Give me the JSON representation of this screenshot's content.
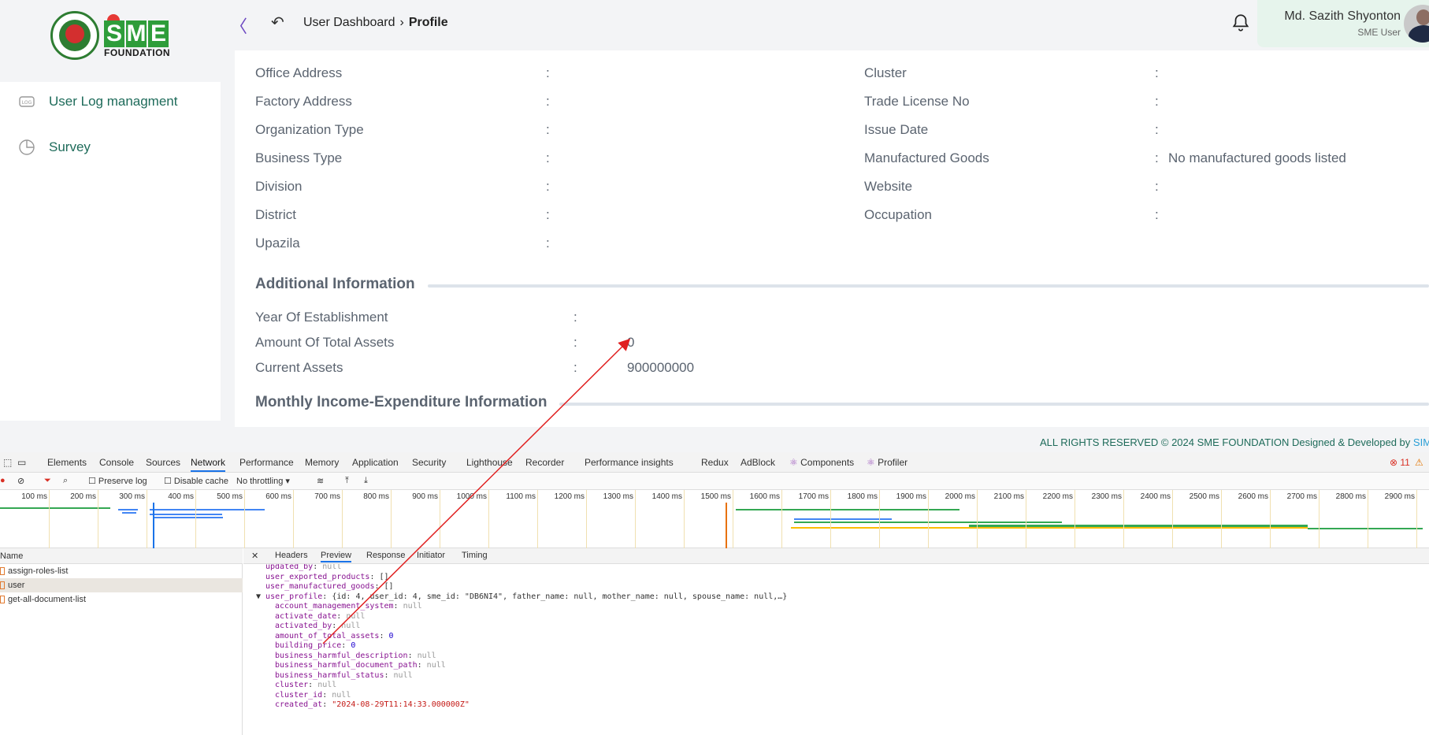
{
  "logo": {
    "sme_letters": [
      "S",
      "M",
      "E"
    ],
    "foundation": "FOUNDATION"
  },
  "header": {
    "breadcrumb": {
      "parent": "User Dashboard",
      "separator": "›",
      "current": "Profile"
    },
    "user": {
      "name": "Md. Sazith Shyonton",
      "role": "SME User"
    }
  },
  "sidebar": {
    "items": [
      {
        "label": "User Log managment",
        "icon": "log-icon"
      },
      {
        "label": "Survey",
        "icon": "pie-chart-icon"
      }
    ]
  },
  "profile": {
    "left_fields": [
      {
        "label": "Office Address",
        "value": ""
      },
      {
        "label": "Factory Address",
        "value": ""
      },
      {
        "label": "Organization Type",
        "value": ""
      },
      {
        "label": "Business Type",
        "value": ""
      },
      {
        "label": "Division",
        "value": ""
      },
      {
        "label": "District",
        "value": ""
      },
      {
        "label": "Upazila",
        "value": ""
      }
    ],
    "right_fields": [
      {
        "label": "Cluster",
        "value": ""
      },
      {
        "label": "Trade License No",
        "value": ""
      },
      {
        "label": "Issue Date",
        "value": ""
      },
      {
        "label": "Manufactured Goods",
        "value": "No manufactured goods listed"
      },
      {
        "label": "Website",
        "value": ""
      },
      {
        "label": "Occupation",
        "value": ""
      }
    ],
    "colon": ":",
    "additional_title": "Additional Information",
    "additional_fields": [
      {
        "label": "Year Of Establishment",
        "value": ""
      },
      {
        "label": "Amount Of Total Assets",
        "value": "0"
      },
      {
        "label": "Current Assets",
        "value": "900000000"
      }
    ],
    "monthly_title": "Monthly Income-Expenditure Information"
  },
  "footer": {
    "text": "ALL RIGHTS RESERVED © 2024 SME FOUNDATION    Designed & Developed by",
    "link": "SIMEC"
  },
  "devtools": {
    "tabs": [
      "Elements",
      "Console",
      "Sources",
      "Network",
      "Performance",
      "Memory",
      "Application",
      "Security",
      "Lighthouse",
      "Recorder",
      "Performance insights",
      "Redux",
      "AdBlock",
      "Components",
      "Profiler"
    ],
    "active_tab": "Network",
    "errors": "11",
    "toolbar": {
      "preserve_log": "Preserve log",
      "disable_cache": "Disable cache",
      "throttling": "No throttling"
    },
    "ticks": [
      "100 ms",
      "200 ms",
      "300 ms",
      "400 ms",
      "500 ms",
      "600 ms",
      "700 ms",
      "800 ms",
      "900 ms",
      "1000 ms",
      "1100 ms",
      "1200 ms",
      "1300 ms",
      "1400 ms",
      "1500 ms",
      "1600 ms",
      "1700 ms",
      "1800 ms",
      "1900 ms",
      "2000 ms",
      "2100 ms",
      "2200 ms",
      "2300 ms",
      "2400 ms",
      "2500 ms",
      "2600 ms",
      "2700 ms",
      "2800 ms",
      "2900 ms"
    ],
    "name_header": "Name",
    "requests": [
      "assign-roles-list",
      "user",
      "get-all-document-list"
    ],
    "detail_tabs": [
      "Headers",
      "Preview",
      "Response",
      "Initiator",
      "Timing"
    ],
    "active_detail_tab": "Preview",
    "preview_lines": [
      {
        "indent": 0,
        "key": "updated_by",
        "value": "null",
        "type": "null"
      },
      {
        "indent": 0,
        "key": "user_exported_products",
        "value": "[]",
        "type": "plain"
      },
      {
        "indent": 0,
        "key": "user_manufactured_goods",
        "value": "[]",
        "type": "plain"
      },
      {
        "indent": 0,
        "key": "user_profile",
        "value": "{id: 4, user_id: 4, sme_id: \"DB6NI4\", father_name: null, mother_name: null, spouse_name: null,…}",
        "type": "plain",
        "expanded": true
      },
      {
        "indent": 1,
        "key": "account_management_system",
        "value": "null",
        "type": "null"
      },
      {
        "indent": 1,
        "key": "activate_date",
        "value": "null",
        "type": "null"
      },
      {
        "indent": 1,
        "key": "activated_by",
        "value": "null",
        "type": "null"
      },
      {
        "indent": 1,
        "key": "amount_of_total_assets",
        "value": "0",
        "type": "num"
      },
      {
        "indent": 1,
        "key": "building_price",
        "value": "0",
        "type": "num"
      },
      {
        "indent": 1,
        "key": "business_harmful_description",
        "value": "null",
        "type": "null"
      },
      {
        "indent": 1,
        "key": "business_harmful_document_path",
        "value": "null",
        "type": "null"
      },
      {
        "indent": 1,
        "key": "business_harmful_status",
        "value": "null",
        "type": "null"
      },
      {
        "indent": 1,
        "key": "cluster",
        "value": "null",
        "type": "null"
      },
      {
        "indent": 1,
        "key": "cluster_id",
        "value": "null",
        "type": "null"
      },
      {
        "indent": 1,
        "key": "created_at",
        "value": "\"2024-08-29T11:14:33.000000Z\"",
        "type": "str"
      }
    ]
  },
  "colors": {
    "accent_green": "#1e6b5a",
    "annotation_red": "#e02020",
    "devtools_blue": "#1a73e8"
  }
}
